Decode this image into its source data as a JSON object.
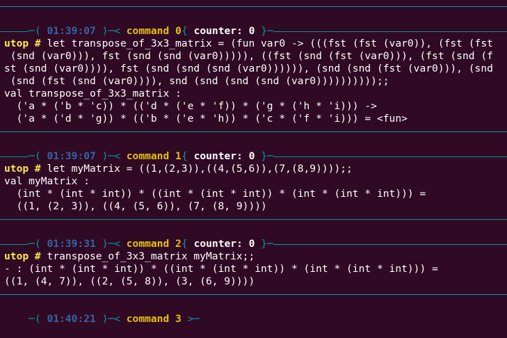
{
  "blocks": [
    {
      "status": {
        "open": "─( ",
        "time": "01:39:07",
        "mid": " )─< ",
        "command": "command 0",
        "close": " >─"
      },
      "counter": {
        "open": "{ ",
        "text": "counter: 0",
        "close": " }─"
      },
      "prompt": "utop #",
      "input_lines": [
        " let transpose_of_3x3_matrix = (fun var0 -> (((fst (fst (var0)), (fst (fst",
        " (snd (var0))), fst (snd (snd (var0))))), ((fst (snd (fst (var0))), (fst (snd (f",
        "st (snd (var0)))), fst (snd (snd (snd (var0)))))), (snd (snd (fst (var0))), (snd",
        " (snd (fst (snd (var0)))), snd (snd (snd (snd (var0))))))))));;"
      ],
      "output_lines": [
        "val transpose_of_3x3_matrix :",
        "  ('a * ('b * 'c)) * (('d * ('e * 'f)) * ('g * ('h * 'i))) ->",
        "  ('a * ('d * 'g)) * (('b * ('e * 'h)) * ('c * ('f * 'i))) = <fun>"
      ]
    },
    {
      "status": {
        "open": "─( ",
        "time": "01:39:07",
        "mid": " )─< ",
        "command": "command 1",
        "close": " >─"
      },
      "counter": {
        "open": "{ ",
        "text": "counter: 0",
        "close": " }─"
      },
      "prompt": "utop #",
      "input_lines": [
        " let myMatrix = ((1,(2,3)),((4,(5,6)),(7,(8,9))));;"
      ],
      "output_lines": [
        "val myMatrix :",
        "  (int * (int * int)) * ((int * (int * int)) * (int * (int * int))) =",
        "  ((1, (2, 3)), ((4, (5, 6)), (7, (8, 9))))"
      ]
    },
    {
      "status": {
        "open": "─( ",
        "time": "01:39:31",
        "mid": " )─< ",
        "command": "command 2",
        "close": " >─"
      },
      "counter": {
        "open": "{ ",
        "text": "counter: 0",
        "close": " }─"
      },
      "prompt": "utop #",
      "input_lines": [
        " transpose_of_3x3_matrix myMatrix;;"
      ],
      "output_lines": [
        "- : (int * (int * int)) * ((int * (int * int)) * (int * (int * int))) =",
        "((1, (4, 7)), ((2, (5, 8)), (3, (6, 9))))"
      ]
    }
  ],
  "final_status": {
    "open": "─( ",
    "time": "01:40:21",
    "mid": " )─< ",
    "command": "command 3",
    "close": " >─"
  },
  "colors": {
    "background": "#300a24",
    "rule": "#06989a",
    "time": "#3465a4",
    "command": "#e5c10f",
    "prompt": "#fce94f"
  }
}
